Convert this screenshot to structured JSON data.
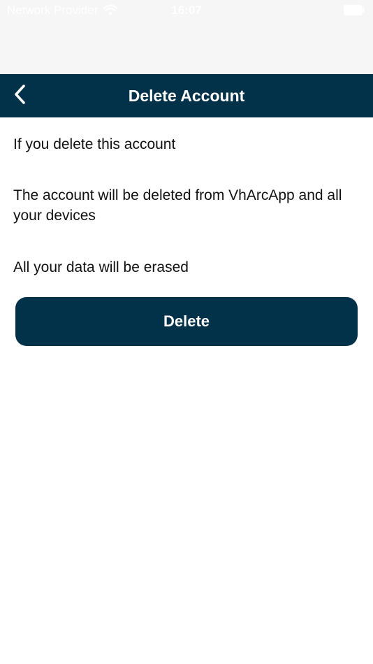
{
  "status_bar": {
    "carrier": "Network Provider",
    "time": "16:07",
    "icons": [
      "wifi-icon",
      "battery-icon"
    ]
  },
  "nav": {
    "title": "Delete Account",
    "back_icon": "chevron-left-icon",
    "background_color": "#02324a"
  },
  "content": {
    "line_1": "If you delete this account",
    "line_2": "The account will be deleted from VhArcApp and all your devices",
    "line_3": "All your data will be erased"
  },
  "actions": {
    "delete_label": "Delete",
    "button_color": "#02324a"
  }
}
